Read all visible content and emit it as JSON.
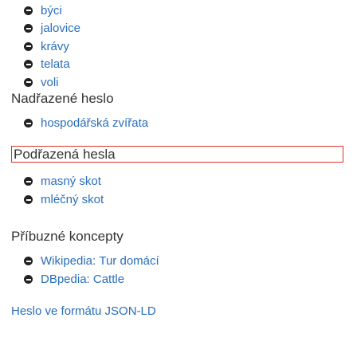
{
  "top_items": [
    {
      "label": "býci"
    },
    {
      "label": "jalovice"
    },
    {
      "label": "krávy"
    },
    {
      "label": "telata"
    },
    {
      "label": "voli"
    }
  ],
  "broader": {
    "heading": "Nadřazené heslo",
    "items": [
      {
        "label": "hospodářská zvířata"
      }
    ]
  },
  "narrower": {
    "heading": "Podřazená hesla",
    "items": [
      {
        "label": "masný skot"
      },
      {
        "label": "mléčný skot"
      }
    ]
  },
  "related": {
    "heading": "Příbuzné koncepty",
    "items": [
      {
        "prefix": "Wikipedia: ",
        "label": "Tur domácí"
      },
      {
        "prefix": "DBpedia: ",
        "label": "Cattle"
      }
    ]
  },
  "jsonld_link": "Heslo ve formátu JSON-LD",
  "colors": {
    "link": "#2a6ebb",
    "highlight_border": "#d9342b",
    "text": "#222222"
  },
  "icons": {
    "bullet": "circle-minus-icon"
  }
}
